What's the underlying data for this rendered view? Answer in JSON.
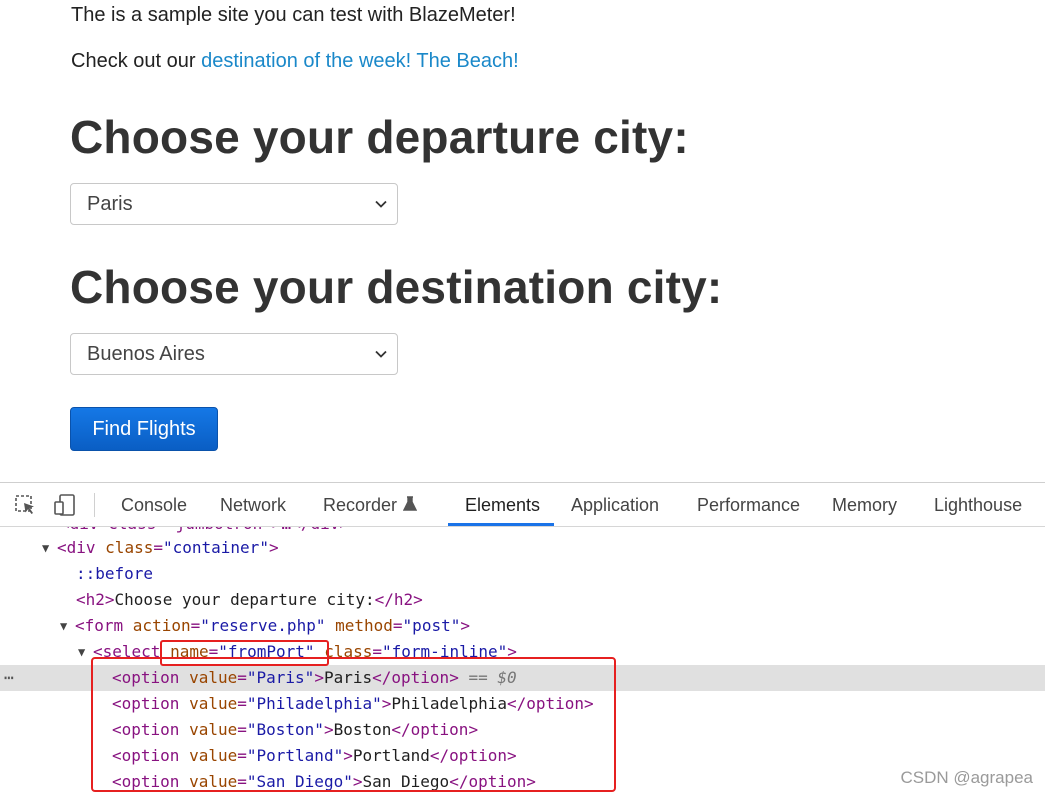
{
  "site": {
    "intro": "The is a sample site you can test with BlazeMeter!",
    "check_prefix": "Check out our ",
    "check_link": "destination of the week! The Beach!",
    "departure_heading": "Choose your departure city:",
    "departure_value": "Paris",
    "destination_heading": "Choose your destination city:",
    "destination_value": "Buenos Aires",
    "find_button": "Find Flights",
    "link_color": "#1a88c9",
    "button_color": "#0a5ec4"
  },
  "devtools": {
    "tools": [
      "inspect-icon",
      "device-toggle-icon"
    ],
    "tabs": [
      "Console",
      "Network",
      "Recorder",
      "Elements",
      "Application",
      "Performance",
      "Memory",
      "Lighthouse"
    ],
    "active_tab": "Elements",
    "recorder_icon": "flask-icon",
    "code": {
      "line0": "<div class=\"jumbotron\">…</div>",
      "line1_tag_open": "<div ",
      "line1_attr": "class",
      "line1_val": "\"container\"",
      "line2": "::before",
      "line3_text": "Choose your departure city:",
      "line4_attr1": "action",
      "line4_val1": "\"reserve.php\"",
      "line4_attr2": "method",
      "line4_val2": "\"post\"",
      "line5_attr1": "name",
      "line5_val1": "\"fromPort\"",
      "line5_attr2": "class",
      "line5_val2": "\"form-inline\"",
      "selected_marker": "== $0",
      "options": [
        {
          "value": "\"Paris\"",
          "text": "Paris"
        },
        {
          "value": "\"Philadelphia\"",
          "text": "Philadelphia"
        },
        {
          "value": "\"Boston\"",
          "text": "Boston"
        },
        {
          "value": "\"Portland\"",
          "text": "Portland"
        },
        {
          "value": "\"San Diego\"",
          "text": "San Diego"
        }
      ]
    },
    "highlight_color": "#e62020"
  },
  "watermark": "CSDN @agrapea"
}
